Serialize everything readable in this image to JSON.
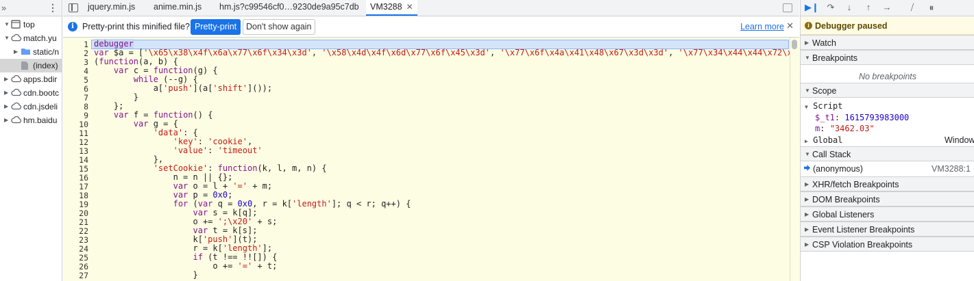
{
  "left": {
    "tree": [
      {
        "label": "top",
        "icon": "frame-icon",
        "expanded": true
      },
      {
        "label": "match.yu",
        "icon": "cloud-icon",
        "expanded": true
      },
      {
        "label": "static/n",
        "icon": "folder-icon",
        "expanded": false
      },
      {
        "label": "(index)",
        "icon": "file-icon",
        "selected": true
      },
      {
        "label": "apps.bdir",
        "icon": "cloud-icon",
        "expanded": false
      },
      {
        "label": "cdn.bootc",
        "icon": "cloud-icon",
        "expanded": false
      },
      {
        "label": "cdn.jsdeli",
        "icon": "cloud-icon",
        "expanded": false
      },
      {
        "label": "hm.baidu",
        "icon": "cloud-icon",
        "expanded": false
      }
    ]
  },
  "tabs": [
    {
      "label": "jquery.min.js"
    },
    {
      "label": "anime.min.js"
    },
    {
      "label": "hm.js?c99546cf0…9230de9a95c7db"
    },
    {
      "label": "VM3288",
      "active": true,
      "closable": true
    }
  ],
  "infobar": {
    "message": "Pretty-print this minified file?",
    "pretty_print_label": "Pretty-print",
    "dont_show_label": "Don't show again",
    "learn_more_label": "Learn more"
  },
  "code": {
    "execution_line": 1,
    "lines": [
      "debugger",
      "var $a = ['\\x65\\x38\\x4f\\x6a\\x77\\x6f\\x34\\x3d', '\\x58\\x4d\\x4f\\x6d\\x77\\x6f\\x45\\x3d', '\\x77\\x6f\\x4a\\x41\\x48\\x67\\x3d\\x3d', '\\x77\\x34\\x44\\x44\\x72\\x",
      "(function(a, b) {",
      "    var c = function(g) {",
      "        while (--g) {",
      "            a['push'](a['shift']());",
      "        }",
      "    };",
      "    var f = function() {",
      "        var g = {",
      "            'data': {",
      "                'key': 'cookie',",
      "                'value': 'timeout'",
      "            },",
      "            'setCookie': function(k, l, m, n) {",
      "                n = n || {};",
      "                var o = l + '=' + m;",
      "                var p = 0x0;",
      "                for (var q = 0x0, r = k['length']; q < r; q++) {",
      "                    var s = k[q];",
      "                    o += ';\\x20' + s;",
      "                    var t = k[s];",
      "                    k['push'](t);",
      "                    r = k['length'];",
      "                    if (t !== !![]) {",
      "                        o += '=' + t;",
      "                    }"
    ]
  },
  "debugger": {
    "paused_label": "Debugger paused",
    "sections": {
      "watch": "Watch",
      "breakpoints": "Breakpoints",
      "no_breakpoints": "No breakpoints",
      "scope": "Scope",
      "call_stack": "Call Stack",
      "xhr": "XHR/fetch Breakpoints",
      "dom": "DOM Breakpoints",
      "global_listeners": "Global Listeners",
      "event_listener": "Event Listener Breakpoints",
      "csp": "CSP Violation Breakpoints"
    },
    "scope": {
      "script_label": "Script",
      "t1_name": "$_t1",
      "t1_value": "1615793983000",
      "m_name": "m",
      "m_value": "\"3462.03\"",
      "global_label": "Global",
      "global_value": "Window"
    },
    "call_stack": {
      "frame_name": "(anonymous)",
      "frame_location": "VM3288:1"
    }
  }
}
